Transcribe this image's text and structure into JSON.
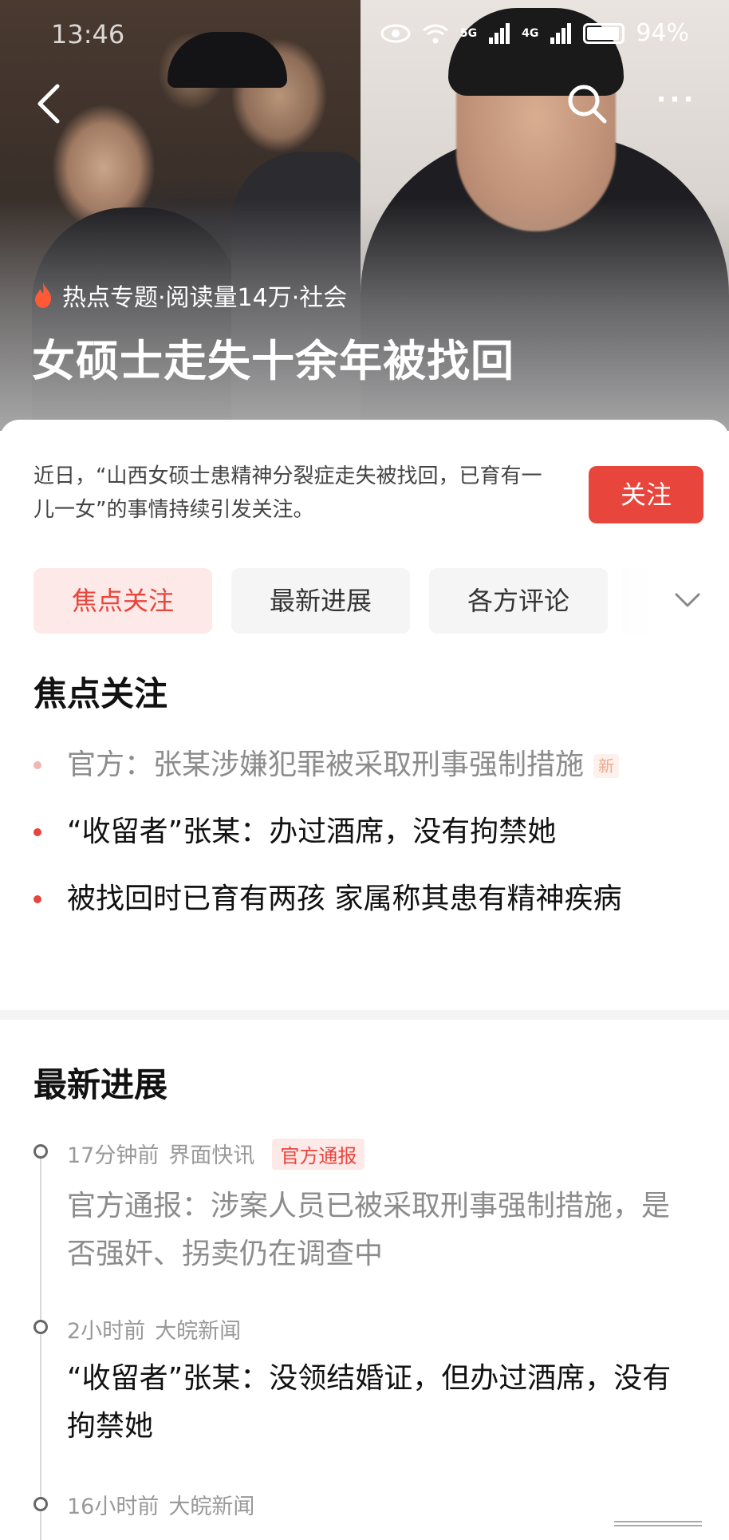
{
  "status_bar": {
    "time": "13:46",
    "battery": "94%",
    "sig1": "5G",
    "sig2": "4G"
  },
  "nav": {
    "more_label": "···"
  },
  "hero": {
    "meta": "热点专题·阅读量14万·社会",
    "title": "女硕士走失十余年被找回"
  },
  "intro": {
    "text": "近日，“山西女硕士患精神分裂症走失被找回，已育有一儿一女”的事情持续引发关注。",
    "follow_label": "关注"
  },
  "tabs": [
    {
      "label": "焦点关注",
      "active": true
    },
    {
      "label": "最新进展",
      "active": false
    },
    {
      "label": "各方评论",
      "active": false
    }
  ],
  "focus": {
    "title": "焦点关注",
    "items": [
      {
        "text": "官方：张某涉嫌犯罪被采取刑事强制措施",
        "badge": "新",
        "read": true
      },
      {
        "text": "“收留者”张某：办过酒席，没有拘禁她",
        "read": false
      },
      {
        "text": "被找回时已育有两孩 家属称其患有精神疾病",
        "read": false
      }
    ]
  },
  "progress": {
    "title": "最新进展",
    "items": [
      {
        "time": "17分钟前",
        "source": "界面快讯",
        "tag": "官方通报",
        "text": "官方通报：涉案人员已被采取刑事强制措施，是否强奸、拐卖仍在调查中",
        "read": true
      },
      {
        "time": "2小时前",
        "source": "大皖新闻",
        "tag": "",
        "text": "“收留者”张某：没领结婚证，但办过酒席，没有拘禁她",
        "read": false
      },
      {
        "time": "16小时前",
        "source": "大皖新闻",
        "tag": "",
        "text": "",
        "read": false
      }
    ]
  },
  "colors": {
    "accent": "#e8453c",
    "accent_light": "#fde9e7"
  }
}
